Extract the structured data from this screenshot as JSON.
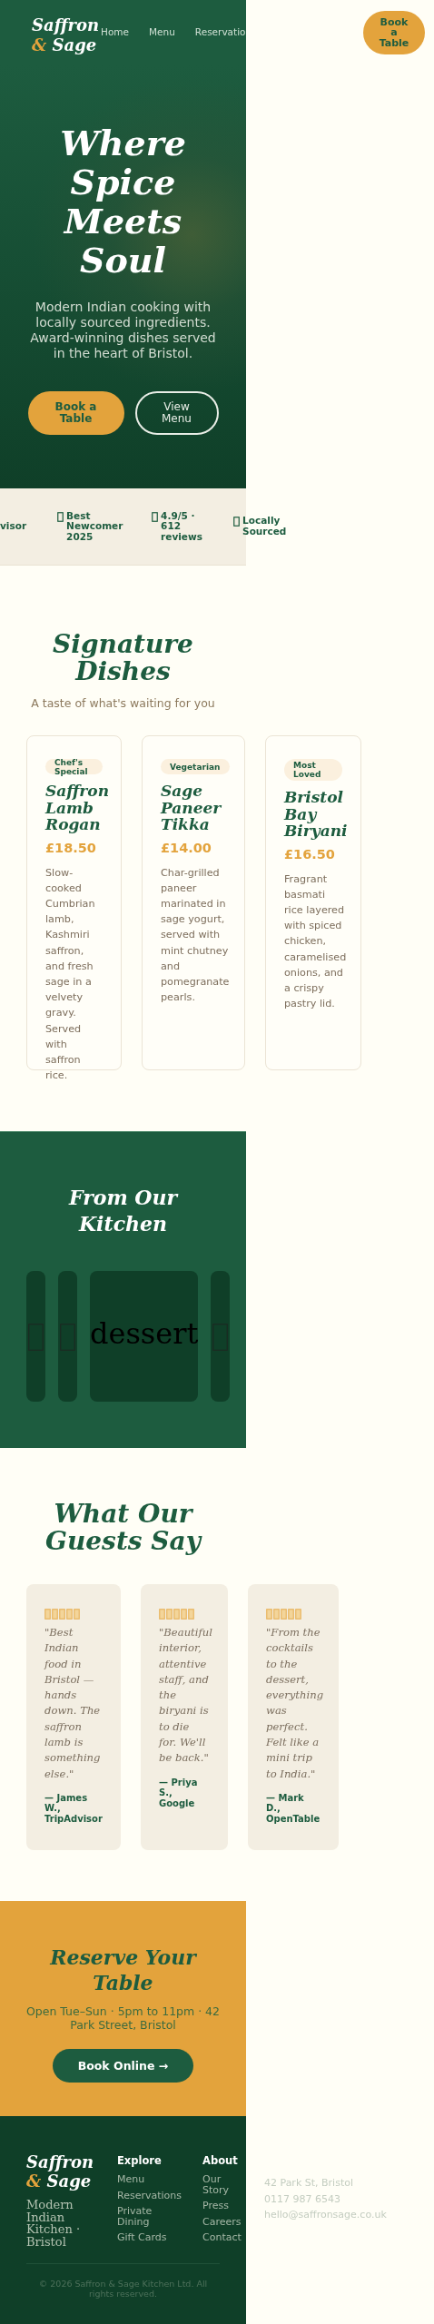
{
  "header": {
    "logo": {
      "first": "Saffron",
      "ampersand": "&",
      "last": "Sage"
    },
    "nav": [
      "Home",
      "Menu",
      "Reservatio"
    ],
    "cta": "Book a Table"
  },
  "hero": {
    "title": "Where Spice Meets Soul",
    "subtitle": "Modern Indian cooking with locally sourced ingredients. Award-winning dishes served in the heart of Bristol.",
    "buttons": [
      {
        "label": "Book a Table",
        "kind": "primary"
      },
      {
        "label": "View Menu",
        "kind": "outline"
      }
    ]
  },
  "trust": [
    {
      "text": "visor",
      "icon": false
    },
    {
      "text": "Best Newcomer 2025",
      "icon": true
    },
    {
      "text": "4.9/5 · 612 reviews",
      "icon": true
    },
    {
      "text": "Locally Sourced",
      "icon": true
    }
  ],
  "dishes": {
    "title": "Signature Dishes",
    "subtitle": "A taste of what's waiting for you",
    "items": [
      {
        "tag": "Chef's Special",
        "name": "Saffron Lamb Rogan",
        "price": "£18.50",
        "description": "Slow-cooked Cumbrian lamb, Kashmiri saffron, and fresh sage in a velvety gravy. Served with saffron rice."
      },
      {
        "tag": "Vegetarian",
        "name": "Sage Paneer Tikka",
        "price": "£14.00",
        "description": "Char-grilled paneer marinated in sage yogurt, served with mint chutney and pomegranate pearls."
      },
      {
        "tag": "Most Loved",
        "name": "Bristol Bay Biryani",
        "price": "£16.50",
        "description": "Fragrant basmati rice layered with spiced chicken, caramelised onions, and a crispy pastry lid."
      }
    ]
  },
  "kitchen": {
    "title": "From Our Kitchen",
    "tiles": [
      {
        "kind": "glyph"
      },
      {
        "kind": "glyph"
      },
      {
        "kind": "text",
        "text": "dessert"
      },
      {
        "kind": "glyph"
      }
    ]
  },
  "reviews": {
    "title": "What Our Guests Say",
    "items": [
      {
        "stars": 5,
        "quote": "\"Best Indian food in Bristol — hands down. The saffron lamb is something else.\"",
        "author": "— James W., TripAdvisor"
      },
      {
        "stars": 5,
        "quote": "\"Beautiful interior, attentive staff, and the biryani is to die for. We'll be back.\"",
        "author": "— Priya S., Google"
      },
      {
        "stars": 5,
        "quote": "\"From the cocktails to the dessert, everything was perfect. Felt like a mini trip to India.\"",
        "author": "— Mark D., OpenTable"
      }
    ]
  },
  "reserve": {
    "title": "Reserve Your Table",
    "subtitle": "Open Tue–Sun · 5pm to 11pm · 42 Park Street, Bristol",
    "button": "Book Online →"
  },
  "footer": {
    "logo": {
      "first": "Saffron",
      "ampersand": "&",
      "last": "Sage"
    },
    "tagline": "Modern Indian Kitchen · Bristol",
    "columns": [
      {
        "heading": "Explore",
        "links": [
          "Menu",
          "Reservations",
          "Private Dining",
          "Gift Cards"
        ]
      },
      {
        "heading": "About",
        "links": [
          "Our Story",
          "Press",
          "Careers",
          "Contact"
        ]
      },
      {
        "links": [
          "42 Park St, Bristol",
          "0117 987 6543",
          "hello@saffronsage.co.uk"
        ]
      }
    ],
    "copyright": "© 2026 Saffron & Sage Kitchen Ltd. All rights reserved."
  }
}
